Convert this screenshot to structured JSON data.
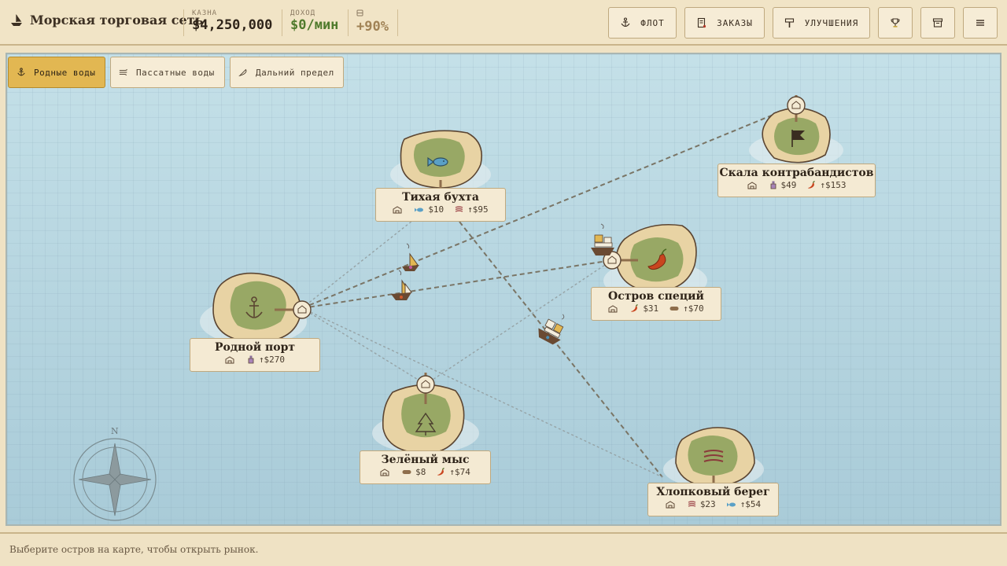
{
  "app": {
    "title": "Морская торговая сеть"
  },
  "stats": [
    {
      "label": "КАЗНА",
      "value": "$4,250,000",
      "color": "#2f2419"
    },
    {
      "label": "ДОХОД",
      "value": "$0/мин",
      "color": "#4f7a2c"
    },
    {
      "label": "",
      "value": "+90%",
      "color": "#a08255"
    }
  ],
  "toolbar": {
    "fleet": "ФЛОТ",
    "orders": "ЗАКАЗЫ",
    "upgrades": "УЛУЧШЕНИЯ"
  },
  "tabs": [
    {
      "label": "Родные воды",
      "active": true
    },
    {
      "label": "Пассатные воды",
      "active": false
    },
    {
      "label": "Дальний предел",
      "active": false
    }
  ],
  "islands": [
    {
      "id": "home",
      "name": "Родной порт",
      "goods": [
        {
          "icon": "potion-icon",
          "text": "↑$270"
        }
      ]
    },
    {
      "id": "calm",
      "name": "Тихая бухта",
      "goods": [
        {
          "icon": "fish-icon",
          "text": "$10"
        },
        {
          "icon": "cloth-icon",
          "text": "↑$95"
        }
      ]
    },
    {
      "id": "smuggler",
      "name": "Скала контрабандистов",
      "goods": [
        {
          "icon": "potion-icon",
          "text": "$49"
        },
        {
          "icon": "pepper-icon",
          "text": "↑$153"
        }
      ]
    },
    {
      "id": "spice",
      "name": "Остров специй",
      "goods": [
        {
          "icon": "pepper-icon",
          "text": "$31"
        },
        {
          "icon": "log-icon",
          "text": "↑$70"
        }
      ]
    },
    {
      "id": "green",
      "name": "Зелёный мыс",
      "goods": [
        {
          "icon": "log-icon",
          "text": "$8"
        },
        {
          "icon": "pepper-icon",
          "text": "↑$74"
        }
      ]
    },
    {
      "id": "cotton",
      "name": "Хлопковый берег",
      "goods": [
        {
          "icon": "cloth-icon",
          "text": "$23"
        },
        {
          "icon": "fish-icon",
          "text": "↑$54"
        }
      ]
    }
  ],
  "compass": {
    "north": "N"
  },
  "status": {
    "text": "Выберите остров на карте, чтобы открыть рынок."
  },
  "colors": {
    "accent": "#e2b752",
    "sand": "#e8d3a4",
    "grass": "#98a865",
    "route": "#7a7566",
    "label_bg": "#f4ead3"
  }
}
